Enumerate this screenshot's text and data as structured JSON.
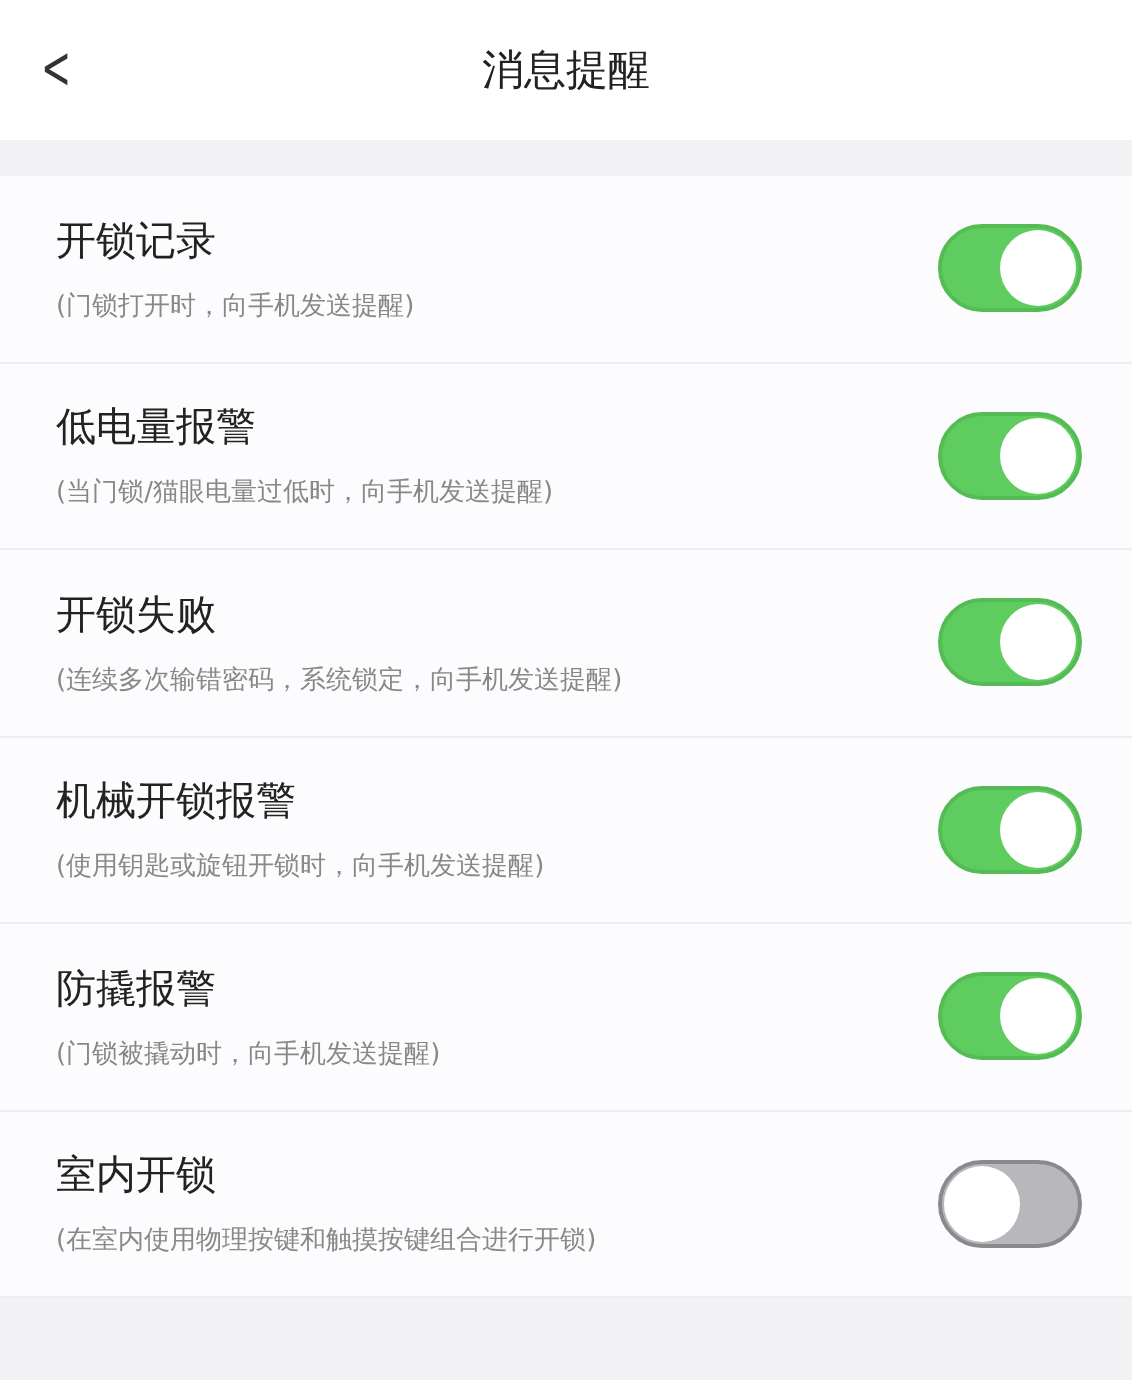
{
  "header": {
    "back": "<",
    "title": "消息提醒"
  },
  "settings": [
    {
      "title": "开锁记录",
      "subtitle": "(门锁打开时，向手机发送提醒)",
      "on": true
    },
    {
      "title": "低电量报警",
      "subtitle": "(当门锁/猫眼电量过低时，向手机发送提醒)",
      "on": true
    },
    {
      "title": "开锁失败",
      "subtitle": "(连续多次输错密码，系统锁定，向手机发送提醒)",
      "on": true
    },
    {
      "title": "机械开锁报警",
      "subtitle": "(使用钥匙或旋钮开锁时，向手机发送提醒)",
      "on": true
    },
    {
      "title": "防撬报警",
      "subtitle": "(门锁被撬动时，向手机发送提醒)",
      "on": true
    },
    {
      "title": "室内开锁",
      "subtitle": "(在室内使用物理按键和触摸按键组合进行开锁)",
      "on": false
    }
  ]
}
